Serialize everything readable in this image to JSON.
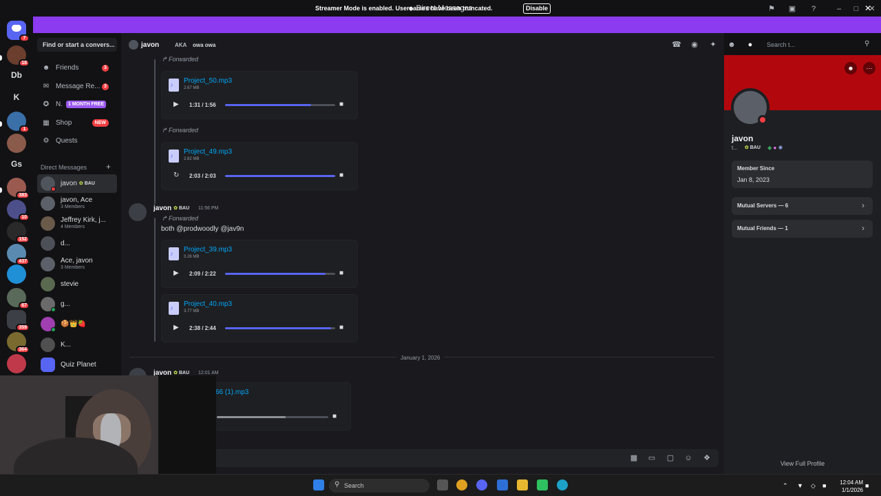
{
  "window": {
    "title": "Direct Messages"
  },
  "banner": {
    "text": "Streamer Mode is enabled. Usernames have been truncated.",
    "button": "Disable"
  },
  "rail": {
    "letters": [
      "Db",
      "K",
      "Gs"
    ],
    "badges": [
      "7",
      "18",
      "1",
      "383",
      "10",
      "152",
      "437",
      "67",
      "359",
      "364"
    ]
  },
  "sidebar": {
    "finder_placeholder": "Find or start a convers...",
    "friends": {
      "label": "Friends",
      "count": "3"
    },
    "message_requests": {
      "label": "Message Re...",
      "count": "3"
    },
    "nitro": {
      "label": "N.",
      "tag": "1 MONTH FREE"
    },
    "shop": {
      "label": "Shop",
      "tag": "NEW"
    },
    "quests": {
      "label": "Quests"
    },
    "dm_header": "Direct Messages",
    "dms": [
      {
        "name": "javon",
        "sub": ""
      },
      {
        "name": "javon, Ace",
        "sub": "3 Members"
      },
      {
        "name": "Jeffrey Kirk, j...",
        "sub": "4 Members"
      },
      {
        "name": "d...",
        "sub": ""
      },
      {
        "name": "Ace, javon",
        "sub": "3 Members"
      },
      {
        "name": "stevie",
        "sub": ""
      },
      {
        "name": "g...",
        "sub": ""
      },
      {
        "name": "🍪👑🍓",
        "sub": ""
      },
      {
        "name": "K...",
        "sub": ""
      },
      {
        "name": "Quiz Planet",
        "sub": ""
      }
    ],
    "tag_text": "BAU"
  },
  "chat_header": {
    "name": "javon",
    "aka_label": "AKA",
    "aka_name": "owa owa",
    "search_placeholder": "Search t..."
  },
  "chat": {
    "forwarded_label": "Forwarded",
    "attachments": [
      {
        "file": "Project_50.mp3",
        "size": "2.67 MB",
        "time": "1:31 / 1:56",
        "progress": 0.78
      },
      {
        "file": "Project_49.mp3",
        "size": "2.82 MB",
        "time": "2:03 / 2:03",
        "progress": 1.0
      },
      {
        "file": "Project_39.mp3",
        "size": "3.26 MB",
        "time": "2:09 / 2:22",
        "progress": 0.91
      },
      {
        "file": "Project_40.mp3",
        "size": "3.77 MB",
        "time": "2:38 / 2:44",
        "progress": 0.96
      },
      {
        "file": "66 (1).mp3",
        "size": "",
        "time": "",
        "progress": 0.62
      }
    ],
    "message1": {
      "author": "javon",
      "tag": "BAU",
      "time": "11:56 PM",
      "text": "both @prodwoodly @jav9n"
    },
    "date_divider": "January 1, 2026",
    "message2": {
      "author": "javon",
      "tag": "BAU",
      "time": "12:01 AM"
    }
  },
  "profile": {
    "name": "javon",
    "tag_line": "t...",
    "tag": "BAU",
    "member_since_label": "Member Since",
    "member_since": "Jan 8, 2023",
    "mutual_servers": "Mutual Servers — 6",
    "mutual_friends": "Mutual Friends — 1",
    "view_full": "View Full Profile"
  },
  "taskbar": {
    "search": "Search",
    "time": "12:04 AM",
    "date": "1/1/2026"
  },
  "colors": {
    "accent": "#5865f2",
    "banner": "#8c3bf0",
    "profile_banner": "#b3070e",
    "dnd": "#f23f43"
  }
}
